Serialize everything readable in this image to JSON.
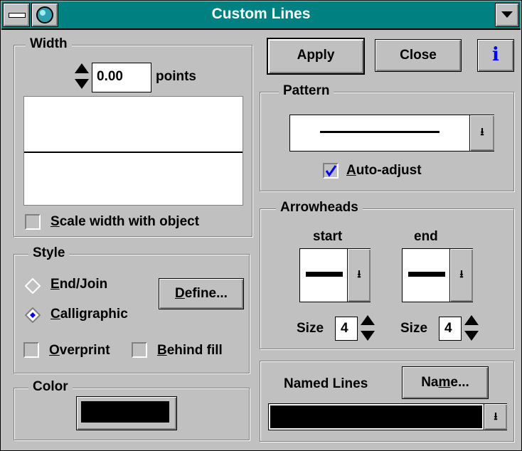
{
  "window": {
    "title": "Custom Lines"
  },
  "width_group": {
    "label": "Width",
    "value": "0.00",
    "unit": "points",
    "scale_label_u": "S",
    "scale_label_rest": "cale width with object"
  },
  "style_group": {
    "label": "Style",
    "endjoin_u": "E",
    "endjoin_rest": "nd/Join",
    "calli_u": "C",
    "calli_rest": "alligraphic",
    "define_u": "D",
    "define_rest": "efine...",
    "overprint_u": "O",
    "overprint_rest": "verprint",
    "behind_u": "B",
    "behind_rest": "ehind fill",
    "selected": "Calligraphic"
  },
  "color_group": {
    "label": "Color",
    "value": "#000000"
  },
  "buttons": {
    "apply": "Apply",
    "close": "Close",
    "info": "i"
  },
  "pattern_group": {
    "label": "Pattern",
    "autoadjust_u": "A",
    "autoadjust_rest": "uto-adjust",
    "autoadjust_checked": true
  },
  "arrowheads_group": {
    "label": "Arrowheads",
    "start_label": "start",
    "end_label": "end",
    "size_label": "Size",
    "start_size": "4",
    "end_size": "4"
  },
  "named_lines": {
    "label": "Named Lines",
    "name_pre": "Na",
    "name_u": "m",
    "name_rest": "e..."
  },
  "icons": [
    "system-menu-icon",
    "globe-icon",
    "dropdown-arrow-icon",
    "spin-arrows-icon",
    "info-icon",
    "checkmark-icon",
    "radio-diamond-icon"
  ]
}
